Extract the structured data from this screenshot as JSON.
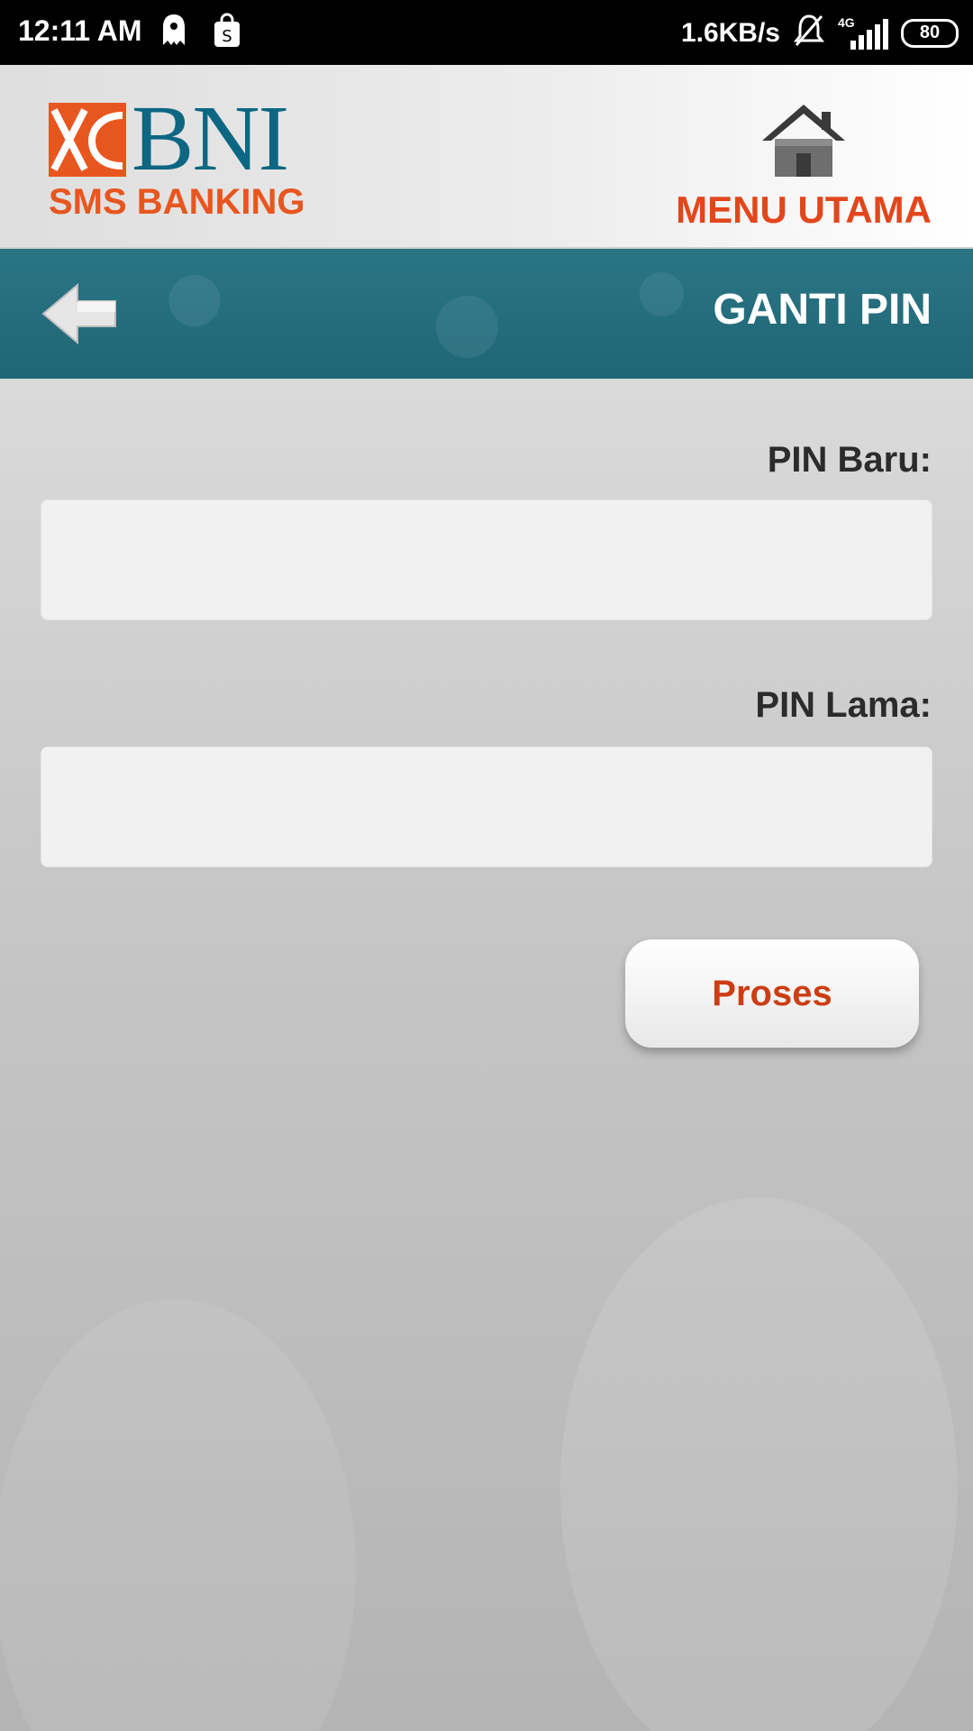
{
  "status_bar": {
    "time": "12:11 AM",
    "speed": "1.6KB/s",
    "network": "4G",
    "battery": "80"
  },
  "header": {
    "brand_name": "BNI",
    "brand_sub": "SMS BANKING",
    "menu_label": "MENU UTAMA",
    "brand_blue": "#0d6783",
    "brand_orange": "#e8561f"
  },
  "title_bar": {
    "title": "GANTI PIN",
    "color": "#23707f"
  },
  "form": {
    "new_pin_label": "PIN Baru:",
    "new_pin_value": "",
    "old_pin_label": "PIN Lama:",
    "old_pin_value": "",
    "submit_label": "Proses"
  }
}
